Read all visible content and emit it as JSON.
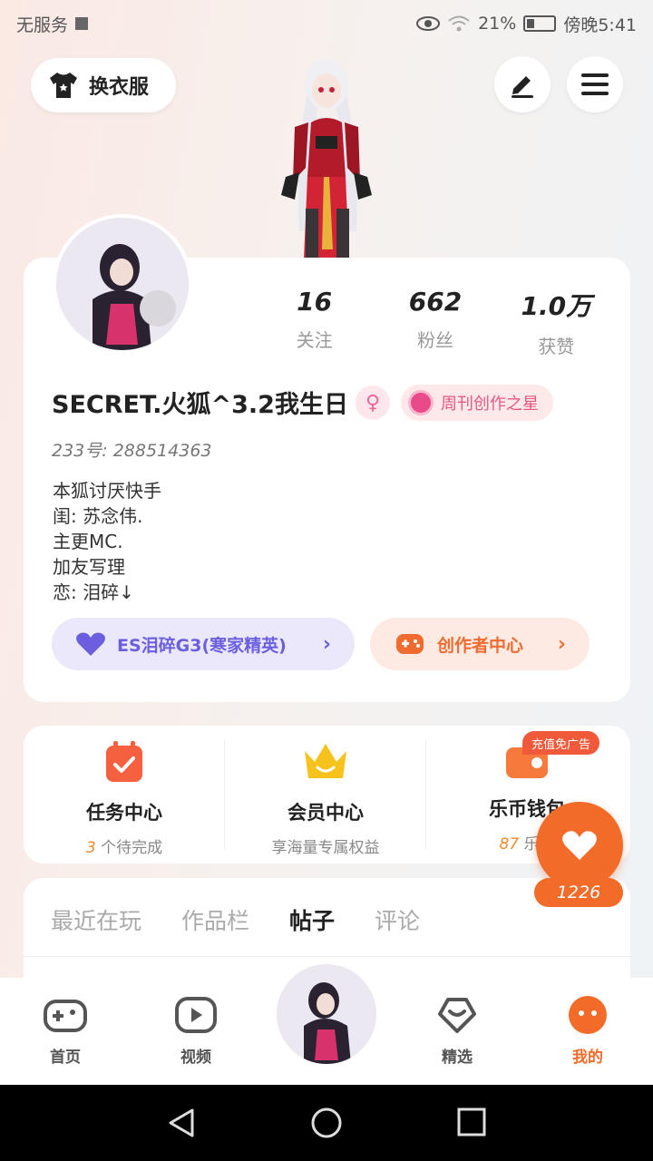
{
  "status_bar": {
    "carrier": "无服务",
    "battery": "21%",
    "time": "傍晚5:41"
  },
  "header": {
    "change_clothes_label": "换衣服",
    "edit_icon": "pencil-icon",
    "menu_icon": "menu-icon"
  },
  "stats": [
    {
      "value": "16",
      "label": "关注"
    },
    {
      "value": "662",
      "label": "粉丝"
    },
    {
      "value": "1.0万",
      "label": "获赞"
    }
  ],
  "profile": {
    "username": "SECRET.火狐^3.2我生日",
    "gender_symbol": "♀",
    "badge_label": "周刊创作之星",
    "uid": "233号: 288514363",
    "bio": [
      "本狐讨厌快手",
      "闺: 苏念伟.",
      "主更MC.",
      "加友写理",
      "恋: 泪碎↓"
    ]
  },
  "buttons": {
    "guild_label": "ES泪碎G3(寒家精英)",
    "creator_label": "创作者中心"
  },
  "features": [
    {
      "title": "任务中心",
      "sub_count": "3",
      "sub_text": "个待完成"
    },
    {
      "title": "会员中心",
      "sub_count": "",
      "sub_text": "享海量专属权益"
    },
    {
      "title": "乐币钱包",
      "sub_count": "87",
      "sub_text": "乐币"
    }
  ],
  "promo_tag": "充值免广告",
  "floating": {
    "count": "1226"
  },
  "tabs": [
    {
      "label": "最近在玩",
      "active": false
    },
    {
      "label": "作品栏",
      "active": false
    },
    {
      "label": "帖子",
      "active": true
    },
    {
      "label": "评论",
      "active": false
    }
  ],
  "bottom_nav": [
    {
      "label": "首页"
    },
    {
      "label": "视频"
    },
    {
      "label": "精选"
    },
    {
      "label": "我的"
    }
  ],
  "colors": {
    "accent": "#f36b28",
    "guild": "#6b5fe0",
    "badge_pink": "#e7577f"
  }
}
